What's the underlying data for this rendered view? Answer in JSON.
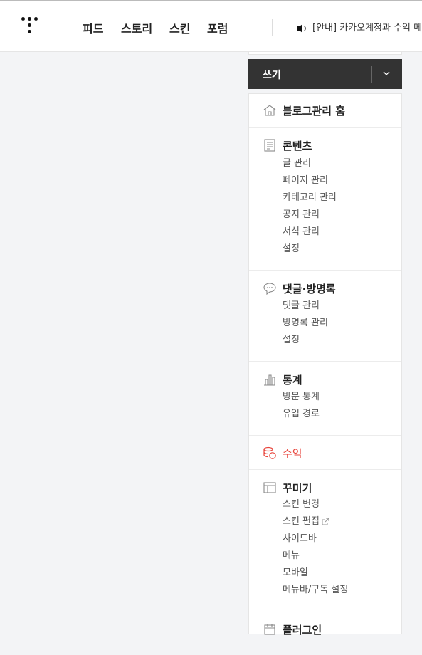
{
  "header": {
    "nav": [
      "피드",
      "스토리",
      "스킨",
      "포럼"
    ],
    "notice": "[안내] 카카오계정과 수익 메뉴"
  },
  "write_button": {
    "label": "쓰기"
  },
  "sidebar": {
    "home": "블로그관리 홈",
    "contents": {
      "title": "콘텐츠",
      "items": [
        "글 관리",
        "페이지 관리",
        "카테고리 관리",
        "공지 관리",
        "서식 관리",
        "설정"
      ]
    },
    "comments": {
      "title": "댓글·방명록",
      "items": [
        "댓글 관리",
        "방명록 관리",
        "설정"
      ]
    },
    "stats": {
      "title": "통계",
      "items": [
        "방문 통계",
        "유입 경로"
      ]
    },
    "revenue": "수익",
    "decorate": {
      "title": "꾸미기",
      "items": [
        "스킨 변경",
        "스킨 편집",
        "사이드바",
        "메뉴",
        "모바일",
        "메뉴바/구독 설정"
      ]
    },
    "plugin": "플러그인"
  },
  "colors": {
    "accent_red": "#e8453c",
    "write_bg": "#333333"
  }
}
